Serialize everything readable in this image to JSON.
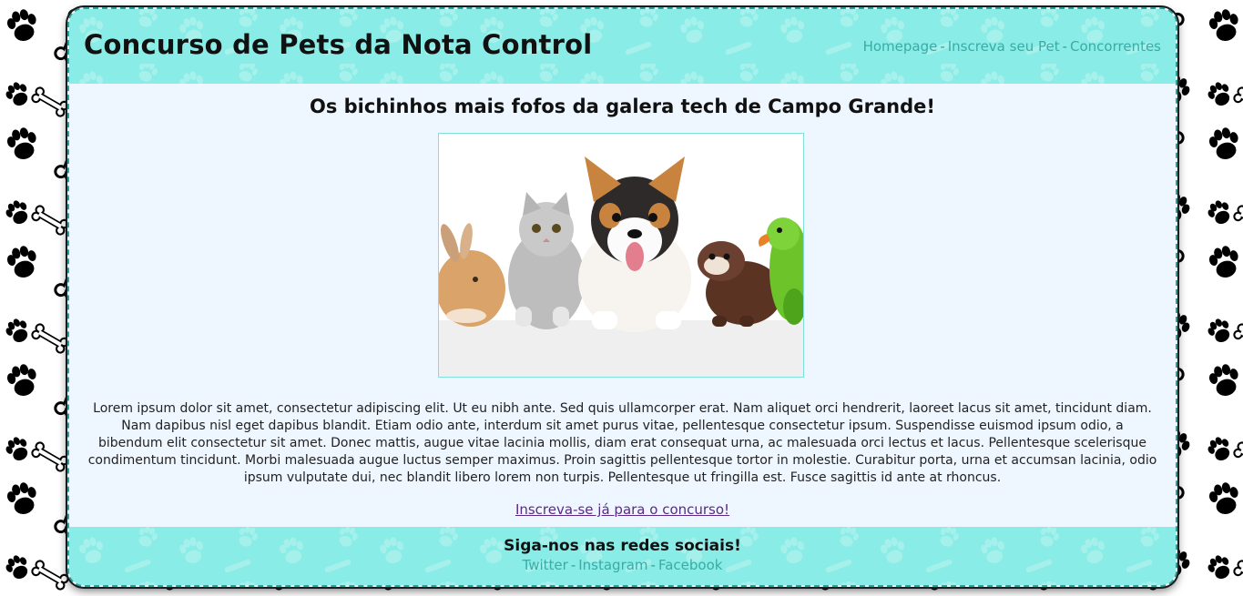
{
  "header": {
    "title": "Concurso de Pets da Nota Control",
    "nav": {
      "home": "Homepage",
      "sep1": "-",
      "register": "Inscreva seu Pet",
      "sep2": "-",
      "contestants": "Concorrentes"
    }
  },
  "main": {
    "headline": "Os bichinhos mais fofos da galera tech de Campo Grande!",
    "image_description_icon": "pets-group-image",
    "paragraph": "Lorem ipsum dolor sit amet, consectetur adipiscing elit. Ut eu nibh ante. Sed quis ullamcorper erat. Nam aliquet orci hendrerit, laoreet lacus sit amet, tincidunt diam. Nam dapibus nisl eget dapibus blandit. Etiam odio ante, interdum sit amet purus vitae, pellentesque consectetur ipsum. Suspendisse euismod ipsum odio, a bibendum elit consectetur sit amet. Donec mattis, augue vitae lacinia mollis, diam erat consequat urna, ac malesuada orci lectus et lacus. Pellentesque scelerisque condimentum tincidunt. Morbi malesuada augue luctus semper maximus. Proin sagittis pellentesque tortor in molestie. Curabitur porta, urna et accumsan lacinia, odio ipsum vulputate dui, nec blandit libero lorem non turpis. Pellentesque ut fringilla est. Fusce sagittis id ante at rhoncus.",
    "cta": "Inscreva-se já para o concurso!"
  },
  "footer": {
    "title": "Siga-nos nas redes sociais!",
    "links": {
      "twitter": "Twitter",
      "sep1": "-",
      "instagram": "Instagram",
      "sep2": "-",
      "facebook": "Facebook"
    }
  },
  "colors": {
    "header_footer_bg": "#89ece6",
    "link": "#3aaba5",
    "content_bg": "#eef6ff",
    "visited_link": "#5b2a86"
  }
}
